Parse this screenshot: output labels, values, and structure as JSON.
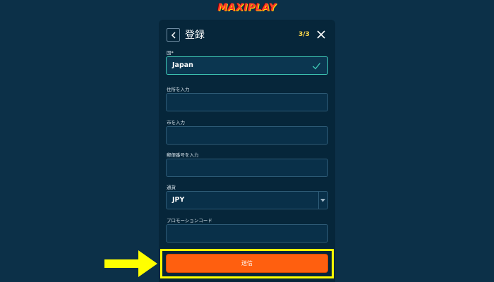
{
  "brand": {
    "logo_text": "MAXIPLAY"
  },
  "modal": {
    "title": "登録",
    "step": "3/3"
  },
  "form": {
    "country": {
      "label": "国",
      "required_mark": "*",
      "value": "Japan"
    },
    "address": {
      "label": "住所を入力",
      "value": ""
    },
    "city": {
      "label": "市を入力",
      "value": ""
    },
    "postal_code": {
      "label": "郵便番号を入力",
      "value": ""
    },
    "currency": {
      "label": "通貨",
      "value": "JPY"
    },
    "promo_code": {
      "label": "プロモーションコード",
      "value": ""
    },
    "submit_label": "送信"
  },
  "colors": {
    "background": "#0c3048",
    "modal": "#06263a",
    "accent": "#ff5f0f",
    "highlight": "#ffff00",
    "valid": "#3fcab7",
    "step": "#ffd84a"
  },
  "icons": {
    "back": "chevron-left-icon",
    "close": "close-icon",
    "valid": "check-icon",
    "dropdown": "chevron-down-icon",
    "pointer": "arrow-right-icon"
  }
}
